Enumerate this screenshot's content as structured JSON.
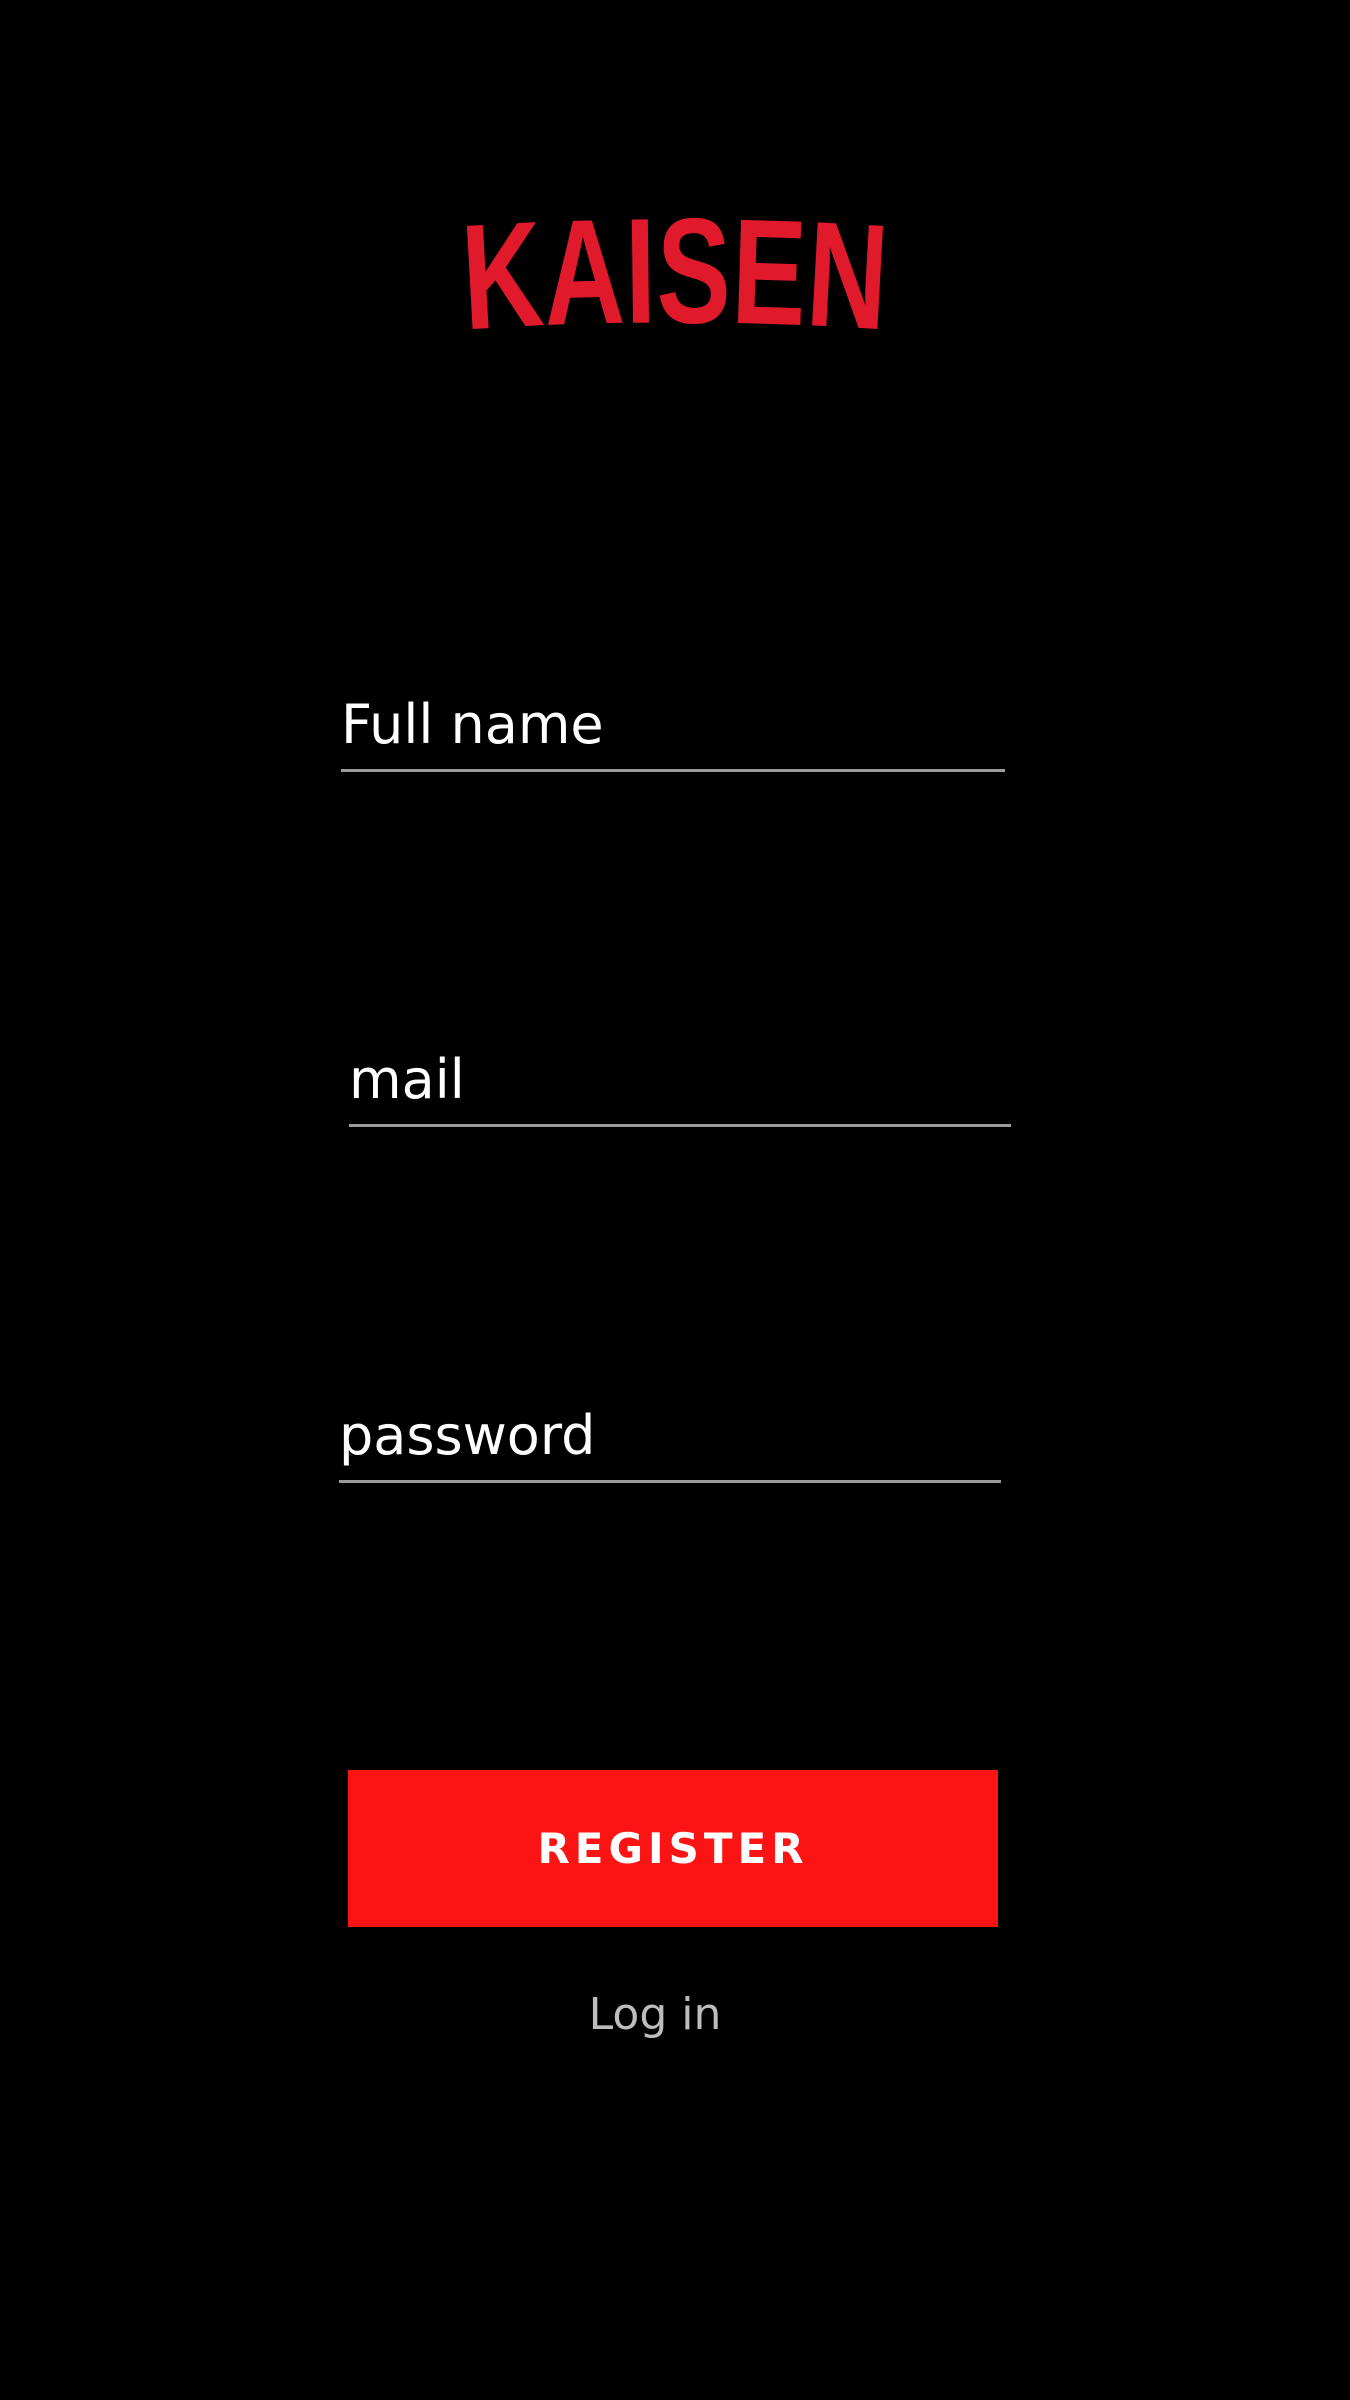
{
  "logo": {
    "text": "KAISEN",
    "color": "#e01a2b"
  },
  "form": {
    "full_name": {
      "placeholder": "Full name",
      "value": ""
    },
    "mail": {
      "placeholder": "mail",
      "value": ""
    },
    "password": {
      "placeholder": "password",
      "value": ""
    }
  },
  "register_button": {
    "label": "REGISTER",
    "color": "#fc1414"
  },
  "login_link": {
    "label": "Log in"
  }
}
